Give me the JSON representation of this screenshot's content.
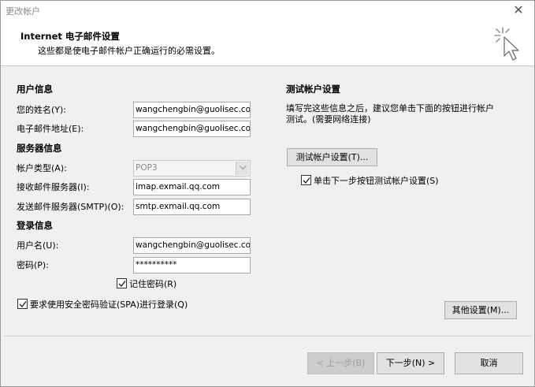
{
  "window": {
    "title": "更改帐户",
    "close_icon": "close-icon"
  },
  "header": {
    "title": "Internet 电子邮件设置",
    "subtitle": "这些都是使电子邮件帐户正确运行的必需设置。",
    "icon": "cursor-sparkle-icon"
  },
  "user_info": {
    "heading": "用户信息",
    "name_label": "您的姓名(Y):",
    "name_value": "wangchengbin@guolisec.com",
    "email_label": "电子邮件地址(E):",
    "email_value": "wangchengbin@guolisec.com"
  },
  "server_info": {
    "heading": "服务器信息",
    "account_type_label": "帐户类型(A):",
    "account_type_value": "POP3",
    "incoming_label": "接收邮件服务器(I):",
    "incoming_value": "imap.exmail.qq.com",
    "outgoing_label": "发送邮件服务器(SMTP)(O):",
    "outgoing_value": "smtp.exmail.qq.com"
  },
  "login_info": {
    "heading": "登录信息",
    "username_label": "用户名(U):",
    "username_value": "wangchengbin@guolisec.com",
    "password_label": "密码(P):",
    "password_value": "**********",
    "remember_label": "记住密码(R)",
    "remember_checked": true,
    "spa_label": "要求使用安全密码验证(SPA)进行登录(Q)",
    "spa_checked": true
  },
  "test_settings": {
    "heading": "测试帐户设置",
    "description_line1": "填写完这些信息之后，建议您单击下面的按钮进行帐户",
    "description_line2": "测试。(需要网络连接)",
    "test_button": "测试帐户设置(T)...",
    "auto_test_label": "单击下一步按钮测试帐户设置(S)",
    "auto_test_checked": true
  },
  "more_settings_button": "其他设置(M)...",
  "footer": {
    "back_button": "< 上一步(B)",
    "next_button": "下一步(N) >",
    "cancel_button": "取消"
  }
}
